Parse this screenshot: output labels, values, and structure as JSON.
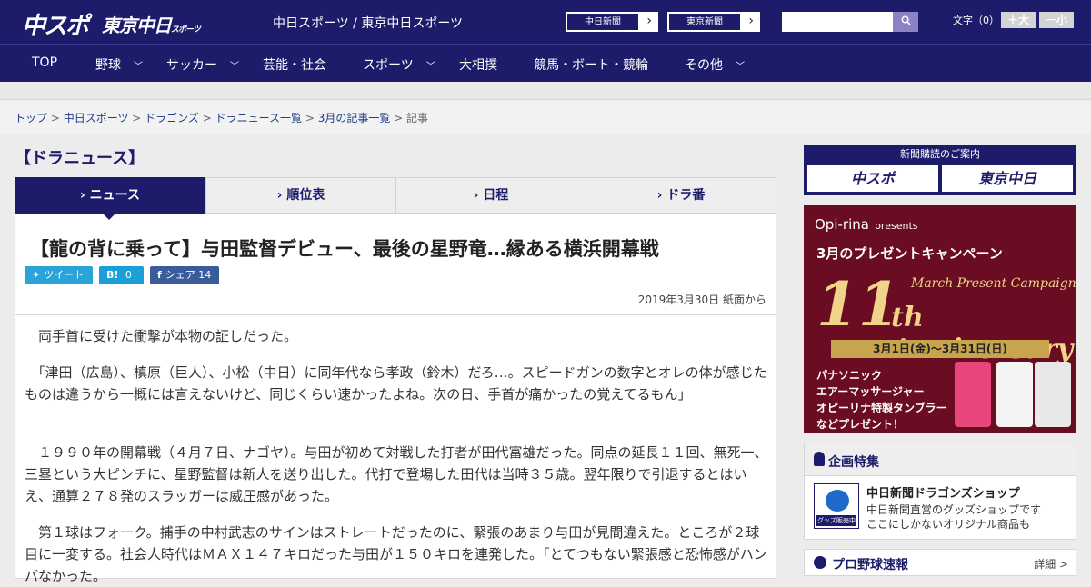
{
  "header": {
    "logo_chuspo": "中スポ",
    "logo_tokyo": "東京中日",
    "logo_tokyo_sub": "スポーツ",
    "site_link": "中日スポーツ / 東京中日スポーツ",
    "btn_chunichi": "中日新聞",
    "btn_tokyo": "東京新聞",
    "search_placeholder": "",
    "font_label": "文字（0）",
    "font_plus": "＋大",
    "font_minus": "－小"
  },
  "nav": [
    {
      "label": "TOP"
    },
    {
      "label": "野球"
    },
    {
      "label": "サッカー"
    },
    {
      "label": "芸能・社会"
    },
    {
      "label": "スポーツ"
    },
    {
      "label": "大相撲"
    },
    {
      "label": "競馬・ボート・競輪"
    },
    {
      "label": "その他"
    }
  ],
  "breadcrumb": {
    "items": [
      "トップ",
      "中日スポーツ",
      "ドラゴンズ",
      "ドラニュース一覧",
      "3月の記事一覧"
    ],
    "current": "記事"
  },
  "section_title": "【ドラニュース】",
  "tabs": [
    {
      "label": "ニュース"
    },
    {
      "label": "順位表"
    },
    {
      "label": "日程"
    },
    {
      "label": "ドラ番"
    }
  ],
  "article": {
    "headline": "【龍の背に乗って】与田監督デビュー、最後の星野竜…縁ある横浜開幕戦",
    "tweet_label": "ツイート",
    "hatena_label": "B!",
    "hatena_count": "0",
    "fb_label": "シェア",
    "fb_count": "14",
    "date": "2019年3月30日 紙面から",
    "paragraphs": [
      "　両手首に受けた衝撃が本物の証しだった。",
      "　「津田（広島）、槙原（巨人）、小松（中日）に同年代なら孝政（鈴木）だろ…。スピードガンの数字とオレの体が感じたものは違うから一概には言えないけど、同じくらい速かったよね。次の日、手首が痛かったの覚えてるもん」",
      "　１９９０年の開幕戦（４月７日、ナゴヤ）。与田が初めて対戦した打者が田代富雄だった。同点の延長１１回、無死一、三塁という大ピンチに、星野監督は新人を送り出した。代打で登場した田代は当時３５歳。翌年限りで引退するとはいえ、通算２７８発のスラッガーは威圧感があった。",
      "　第１球はフォーク。捕手の中村武志のサインはストレートだったのに、緊張のあまり与田が見間違えた。ところが２球目に一変する。社会人時代はＭＡＸ１４７キロだった与田が１５０キロを連発した。「とてつもない緊張感と恐怖感がハンパなかった。"
    ]
  },
  "sidebar": {
    "subscribe_title": "新聞購読のご案内",
    "subscribe_chuspo": "中スポ",
    "subscribe_tokyo": "東京中日",
    "promo": {
      "brand": "Opi-rina",
      "brand_sub": "presents",
      "campaign": "3月のプレゼントキャンペーン",
      "num": "11",
      "mpc": "March Present Campaign",
      "anniv": "th Anniversary",
      "period": "3月1日(金)～3月31日(日)",
      "gift_line1": "パナソニック",
      "gift_line2": "エアーマッサージャー",
      "gift_line3": "オピーリナ特製タンブラー",
      "gift_line4": "などプレゼント！"
    },
    "feature": {
      "title": "企画特集",
      "thumb_label": "グッズ販売中",
      "item_title": "中日新聞ドラゴンズショップ",
      "item_line1": "中日新聞直営のグッズショップです",
      "item_line2": "ここにしかないオリジナル商品も"
    },
    "baseball": {
      "title": "プロ野球速報",
      "more": "詳細 >"
    }
  }
}
